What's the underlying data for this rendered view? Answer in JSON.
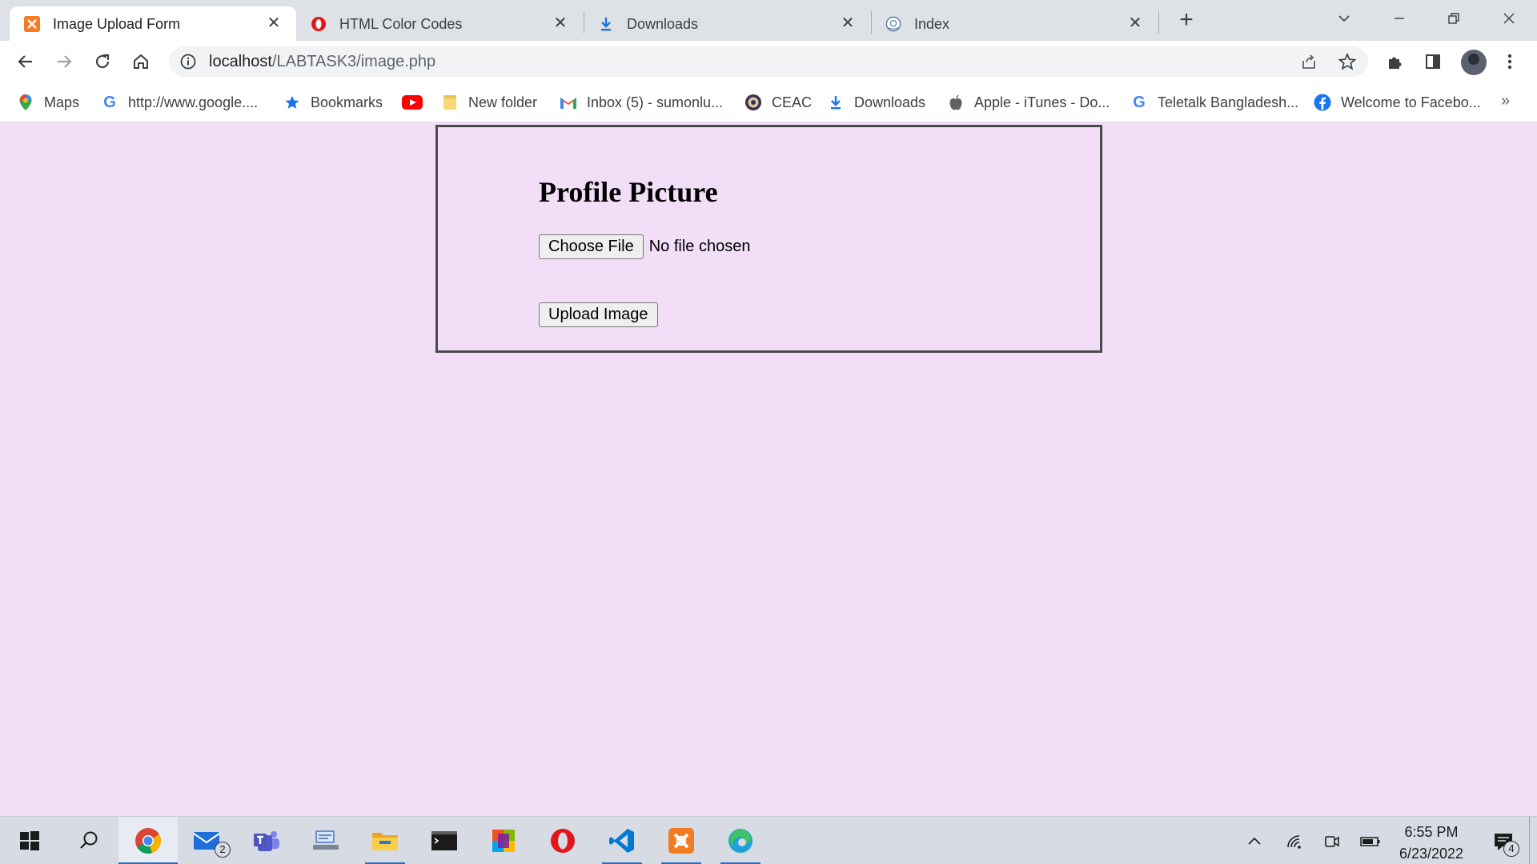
{
  "browser": {
    "tabs": [
      {
        "title": "Image Upload Form",
        "icon": "xampp-icon",
        "active": true
      },
      {
        "title": "HTML Color Codes",
        "icon": "opera-icon",
        "active": false
      },
      {
        "title": "Downloads",
        "icon": "download-icon",
        "active": false
      },
      {
        "title": "Index",
        "icon": "globe-icon",
        "active": false
      }
    ],
    "new_tab_label": "+",
    "url": {
      "host": "localhost",
      "path": "/LABTASK3/image.php"
    }
  },
  "bookmarks": [
    {
      "label": "Maps",
      "icon": "maps-pin-icon"
    },
    {
      "label": "http://www.google....",
      "icon": "google-icon"
    },
    {
      "label": "Bookmarks",
      "icon": "star-icon"
    },
    {
      "label": "",
      "icon": "youtube-icon"
    },
    {
      "label": "New folder",
      "icon": "folder-icon"
    },
    {
      "label": "Inbox (5) - sumonlu...",
      "icon": "gmail-icon"
    },
    {
      "label": "CEAC",
      "icon": "seal-icon"
    },
    {
      "label": "Downloads",
      "icon": "download-icon"
    },
    {
      "label": "Apple - iTunes - Do...",
      "icon": "apple-icon"
    },
    {
      "label": "Teletalk Bangladesh...",
      "icon": "google-icon"
    },
    {
      "label": "Welcome to Facebo...",
      "icon": "facebook-icon"
    }
  ],
  "bookmarks_overflow": "»",
  "form": {
    "title": "Profile Picture",
    "choose_file_label": "Choose File",
    "file_status": "No file chosen",
    "upload_label": "Upload Image"
  },
  "taskbar": {
    "apps": [
      "start",
      "search",
      "chrome",
      "mail",
      "teams",
      "network-settings",
      "file-explorer",
      "terminal",
      "office",
      "opera",
      "vscode",
      "xampp",
      "edge"
    ],
    "mail_badge": "2",
    "time": "6:55 PM",
    "date": "6/23/2022",
    "notification_count": "4"
  },
  "colors": {
    "page_background": "#f2def6",
    "tabstrip_background": "#dee1e6",
    "form_border": "#4a4a4a"
  }
}
